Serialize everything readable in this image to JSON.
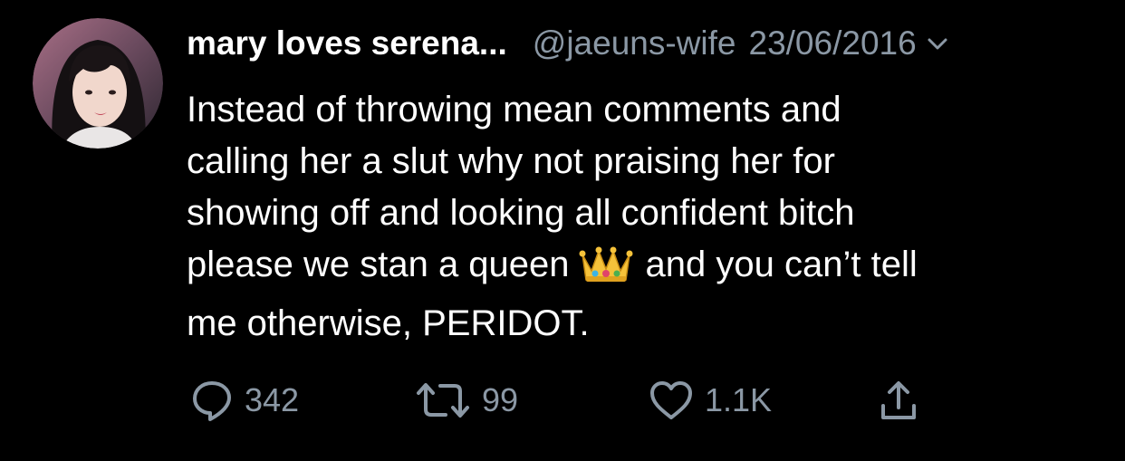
{
  "tweet": {
    "display_name": "mary loves serena...",
    "handle": "@jaeuns-wife",
    "date": "23/06/2016",
    "text_before_emoji": "Instead of throwing mean comments and\ncalling her a slut why not praising her for\nshowing off and looking all confident bitch\nplease we stan a queen",
    "emoji": "crown-emoji",
    "text_after_emoji": "and you can’t tell\nme otherwise, PERIDOT.",
    "actions": {
      "replies": "342",
      "retweets": "99",
      "likes": "1.1K"
    }
  },
  "colors": {
    "background": "#000000",
    "primary_text": "#ffffff",
    "secondary_text": "#8b98a5"
  },
  "icons": {
    "reply": "reply-icon",
    "retweet": "retweet-icon",
    "like": "heart-icon",
    "share": "share-icon",
    "menu": "chevron-down-icon"
  }
}
